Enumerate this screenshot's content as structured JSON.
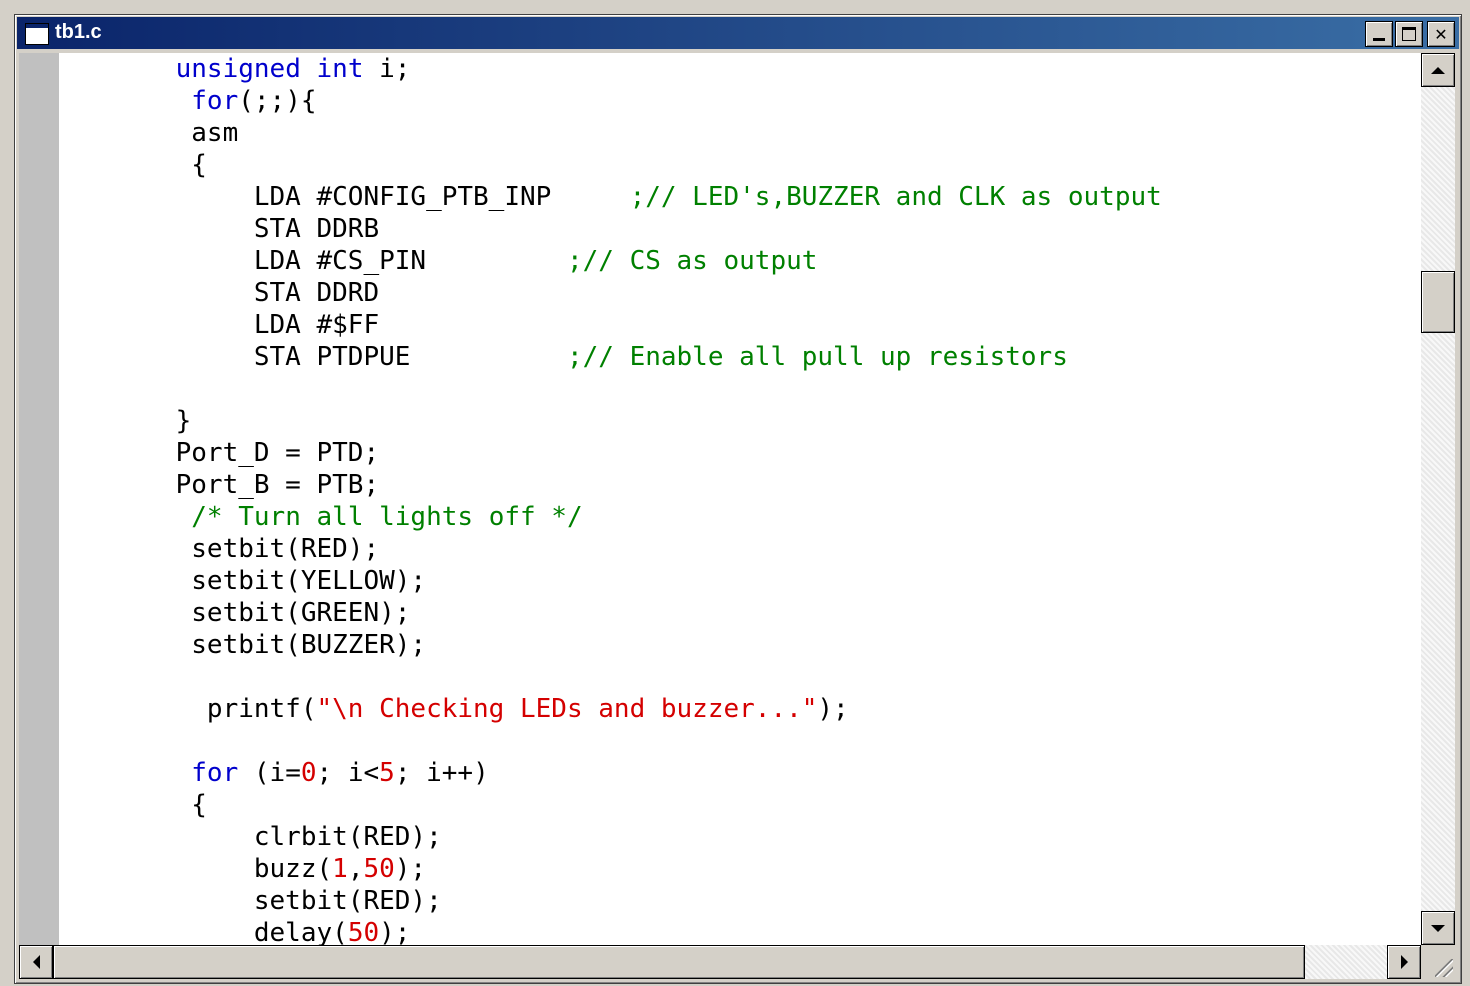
{
  "window": {
    "title": "tb1.c"
  },
  "titlebar_buttons": {
    "minimize": "minimize",
    "maximize": "maximize",
    "close": "✕"
  },
  "editor": {
    "lines": [
      "    <span class=\"kw\">unsigned</span> <span class=\"kw\">int</span> i;",
      "     <span class=\"kw\">for</span>(;;){",
      "     asm",
      "     {",
      "         LDA #CONFIG_PTB_INP     <span class=\"cm\">;// LED's,BUZZER and CLK as output</span>",
      "         STA DDRB",
      "         LDA #CS_PIN         <span class=\"cm\">;// CS as output</span>",
      "         STA DDRD",
      "         LDA #$FF",
      "         STA PTDPUE          <span class=\"cm\">;// Enable all pull up resistors</span>",
      "",
      "    }",
      "    Port_D = PTD;",
      "    Port_B = PTB;",
      "     <span class=\"cm\">/* Turn all lights off */</span>",
      "     setbit(RED);",
      "     setbit(YELLOW);",
      "     setbit(GREEN);",
      "     setbit(BUZZER);",
      "",
      "      printf(<span class=\"st\">\"\\n Checking LEDs and buzzer...\"</span>);",
      "",
      "     <span class=\"kw\">for</span> (i=<span class=\"nm\">0</span>; i&lt;<span class=\"nm\">5</span>; i++)",
      "     {",
      "         clrbit(RED);",
      "         buzz(<span class=\"nm\">1</span>,<span class=\"nm\">50</span>);",
      "         setbit(RED);",
      "         delay(<span class=\"nm\">50</span>);"
    ]
  },
  "colors": {
    "keyword": "#0000cc",
    "comment": "#008000",
    "string": "#d40000",
    "titlebar_start": "#0a246a",
    "titlebar_end": "#3a6ea5"
  },
  "icons": {
    "window_icon": "document-icon",
    "scroll_up": "up-arrow-icon",
    "scroll_down": "down-arrow-icon",
    "scroll_left": "left-arrow-icon",
    "scroll_right": "right-arrow-icon",
    "resize": "size-grip-icon"
  }
}
